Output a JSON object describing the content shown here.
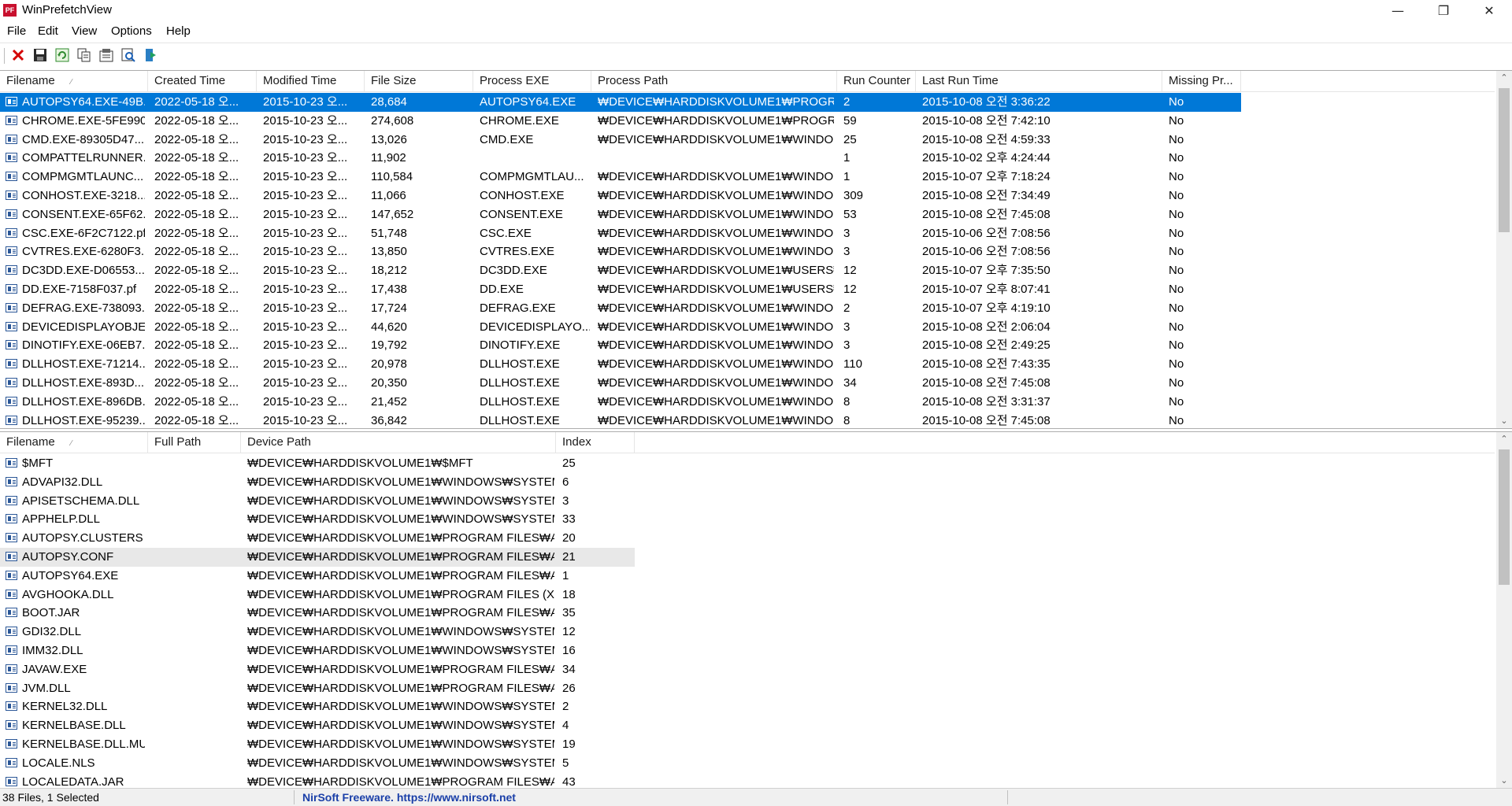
{
  "window": {
    "title": "WinPrefetchView",
    "app_icon_text": "PF"
  },
  "menu": [
    "File",
    "Edit",
    "View",
    "Options",
    "Help"
  ],
  "toolbar_icons": [
    "delete-icon",
    "save-icon",
    "refresh-icon",
    "copy-icon",
    "properties-icon",
    "find-icon",
    "exit-icon"
  ],
  "top_table": {
    "columns": [
      "Filename",
      "Created Time",
      "Modified Time",
      "File Size",
      "Process EXE",
      "Process Path",
      "Run Counter",
      "Last Run Time",
      "Missing Pr..."
    ],
    "rows": [
      [
        "AUTOPSY64.EXE-49B...",
        "2022-05-18 오...",
        "2015-10-23 오...",
        "28,684",
        "AUTOPSY64.EXE",
        "₩DEVICE₩HARDDISKVOLUME1₩PROGRA...",
        "2",
        "2015-10-08 오전 3:36:22",
        "No"
      ],
      [
        "CHROME.EXE-5FE990...",
        "2022-05-18 오...",
        "2015-10-23 오...",
        "274,608",
        "CHROME.EXE",
        "₩DEVICE₩HARDDISKVOLUME1₩PROGRA...",
        "59",
        "2015-10-08 오전 7:42:10",
        "No"
      ],
      [
        "CMD.EXE-89305D47....",
        "2022-05-18 오...",
        "2015-10-23 오...",
        "13,026",
        "CMD.EXE",
        "₩DEVICE₩HARDDISKVOLUME1₩WINDO...",
        "25",
        "2015-10-08 오전 4:59:33",
        "No"
      ],
      [
        "COMPATTELRUNNER....",
        "2022-05-18 오...",
        "2015-10-23 오...",
        "11,902",
        "",
        "",
        "1",
        "2015-10-02 오후 4:24:44",
        "No"
      ],
      [
        "COMPMGMTLAUNC...",
        "2022-05-18 오...",
        "2015-10-23 오...",
        "110,584",
        "COMPMGMTLAU...",
        "₩DEVICE₩HARDDISKVOLUME1₩WINDO...",
        "1",
        "2015-10-07 오후 7:18:24",
        "No"
      ],
      [
        "CONHOST.EXE-3218...",
        "2022-05-18 오...",
        "2015-10-23 오...",
        "11,066",
        "CONHOST.EXE",
        "₩DEVICE₩HARDDISKVOLUME1₩WINDO...",
        "309",
        "2015-10-08 오전 7:34:49",
        "No"
      ],
      [
        "CONSENT.EXE-65F62...",
        "2022-05-18 오...",
        "2015-10-23 오...",
        "147,652",
        "CONSENT.EXE",
        "₩DEVICE₩HARDDISKVOLUME1₩WINDO...",
        "53",
        "2015-10-08 오전 7:45:08",
        "No"
      ],
      [
        "CSC.EXE-6F2C7122.pf",
        "2022-05-18 오...",
        "2015-10-23 오...",
        "51,748",
        "CSC.EXE",
        "₩DEVICE₩HARDDISKVOLUME1₩WINDO...",
        "3",
        "2015-10-06 오전 7:08:56",
        "No"
      ],
      [
        "CVTRES.EXE-6280F3...",
        "2022-05-18 오...",
        "2015-10-23 오...",
        "13,850",
        "CVTRES.EXE",
        "₩DEVICE₩HARDDISKVOLUME1₩WINDO...",
        "3",
        "2015-10-06 오전 7:08:56",
        "No"
      ],
      [
        "DC3DD.EXE-D06553...",
        "2022-05-18 오...",
        "2015-10-23 오...",
        "18,212",
        "DC3DD.EXE",
        "₩DEVICE₩HARDDISKVOLUME1₩USERS₩...",
        "12",
        "2015-10-07 오후 7:35:50",
        "No"
      ],
      [
        "DD.EXE-7158F037.pf",
        "2022-05-18 오...",
        "2015-10-23 오...",
        "17,438",
        "DD.EXE",
        "₩DEVICE₩HARDDISKVOLUME1₩USERS₩...",
        "12",
        "2015-10-07 오후 8:07:41",
        "No"
      ],
      [
        "DEFRAG.EXE-738093...",
        "2022-05-18 오...",
        "2015-10-23 오...",
        "17,724",
        "DEFRAG.EXE",
        "₩DEVICE₩HARDDISKVOLUME1₩WINDO...",
        "2",
        "2015-10-07 오후 4:19:10",
        "No"
      ],
      [
        "DEVICEDISPLAYOBJE...",
        "2022-05-18 오...",
        "2015-10-23 오...",
        "44,620",
        "DEVICEDISPLAYO...",
        "₩DEVICE₩HARDDISKVOLUME1₩WINDO...",
        "3",
        "2015-10-08 오전 2:06:04",
        "No"
      ],
      [
        "DINOTIFY.EXE-06EB7...",
        "2022-05-18 오...",
        "2015-10-23 오...",
        "19,792",
        "DINOTIFY.EXE",
        "₩DEVICE₩HARDDISKVOLUME1₩WINDO...",
        "3",
        "2015-10-08 오전 2:49:25",
        "No"
      ],
      [
        "DLLHOST.EXE-71214...",
        "2022-05-18 오...",
        "2015-10-23 오...",
        "20,978",
        "DLLHOST.EXE",
        "₩DEVICE₩HARDDISKVOLUME1₩WINDO...",
        "110",
        "2015-10-08 오전 7:43:35",
        "No"
      ],
      [
        "DLLHOST.EXE-893D...",
        "2022-05-18 오...",
        "2015-10-23 오...",
        "20,350",
        "DLLHOST.EXE",
        "₩DEVICE₩HARDDISKVOLUME1₩WINDO...",
        "34",
        "2015-10-08 오전 7:45:08",
        "No"
      ],
      [
        "DLLHOST.EXE-896DB...",
        "2022-05-18 오...",
        "2015-10-23 오...",
        "21,452",
        "DLLHOST.EXE",
        "₩DEVICE₩HARDDISKVOLUME1₩WINDO...",
        "8",
        "2015-10-08 오전 3:31:37",
        "No"
      ],
      [
        "DLLHOST.EXE-95239...",
        "2022-05-18 오...",
        "2015-10-23 오...",
        "36,842",
        "DLLHOST.EXE",
        "₩DEVICE₩HARDDISKVOLUME1₩WINDO...",
        "8",
        "2015-10-08 오전 7:45:08",
        "No"
      ]
    ]
  },
  "bottom_table": {
    "columns": [
      "Filename",
      "Full Path",
      "Device Path",
      "Index"
    ],
    "rows": [
      [
        "$MFT",
        "",
        "₩DEVICE₩HARDDISKVOLUME1₩$MFT",
        "25"
      ],
      [
        "ADVAPI32.DLL",
        "",
        "₩DEVICE₩HARDDISKVOLUME1₩WINDOWS₩SYSTEM...",
        "6"
      ],
      [
        "APISETSCHEMA.DLL",
        "",
        "₩DEVICE₩HARDDISKVOLUME1₩WINDOWS₩SYSTEM...",
        "3"
      ],
      [
        "APPHELP.DLL",
        "",
        "₩DEVICE₩HARDDISKVOLUME1₩WINDOWS₩SYSTEM...",
        "33"
      ],
      [
        "AUTOPSY.CLUSTERS",
        "",
        "₩DEVICE₩HARDDISKVOLUME1₩PROGRAM FILES₩AU...",
        "20"
      ],
      [
        "AUTOPSY.CONF",
        "",
        "₩DEVICE₩HARDDISKVOLUME1₩PROGRAM FILES₩AU...",
        "21"
      ],
      [
        "AUTOPSY64.EXE",
        "",
        "₩DEVICE₩HARDDISKVOLUME1₩PROGRAM FILES₩AU...",
        "1"
      ],
      [
        "AVGHOOKA.DLL",
        "",
        "₩DEVICE₩HARDDISKVOLUME1₩PROGRAM FILES (X8...",
        "18"
      ],
      [
        "BOOT.JAR",
        "",
        "₩DEVICE₩HARDDISKVOLUME1₩PROGRAM FILES₩AU...",
        "35"
      ],
      [
        "GDI32.DLL",
        "",
        "₩DEVICE₩HARDDISKVOLUME1₩WINDOWS₩SYSTEM...",
        "12"
      ],
      [
        "IMM32.DLL",
        "",
        "₩DEVICE₩HARDDISKVOLUME1₩WINDOWS₩SYSTEM...",
        "16"
      ],
      [
        "JAVAW.EXE",
        "",
        "₩DEVICE₩HARDDISKVOLUME1₩PROGRAM FILES₩AU...",
        "34"
      ],
      [
        "JVM.DLL",
        "",
        "₩DEVICE₩HARDDISKVOLUME1₩PROGRAM FILES₩AU...",
        "26"
      ],
      [
        "KERNEL32.DLL",
        "",
        "₩DEVICE₩HARDDISKVOLUME1₩WINDOWS₩SYSTEM...",
        "2"
      ],
      [
        "KERNELBASE.DLL",
        "",
        "₩DEVICE₩HARDDISKVOLUME1₩WINDOWS₩SYSTEM...",
        "4"
      ],
      [
        "KERNELBASE.DLL.MUI",
        "",
        "₩DEVICE₩HARDDISKVOLUME1₩WINDOWS₩SYSTEM...",
        "19"
      ],
      [
        "LOCALE.NLS",
        "",
        "₩DEVICE₩HARDDISKVOLUME1₩WINDOWS₩SYSTEM...",
        "5"
      ],
      [
        "LOCALEDATA.JAR",
        "",
        "₩DEVICE₩HARDDISKVOLUME1₩PROGRAM FILES₩AU...",
        "43"
      ]
    ]
  },
  "status": {
    "files": "38 Files, 1 Selected",
    "link": "NirSoft Freeware. https://www.nirsoft.net"
  },
  "colors": {
    "selection": "#0078d7",
    "link": "#1a3fa8",
    "app_icon": "#c8102e"
  }
}
